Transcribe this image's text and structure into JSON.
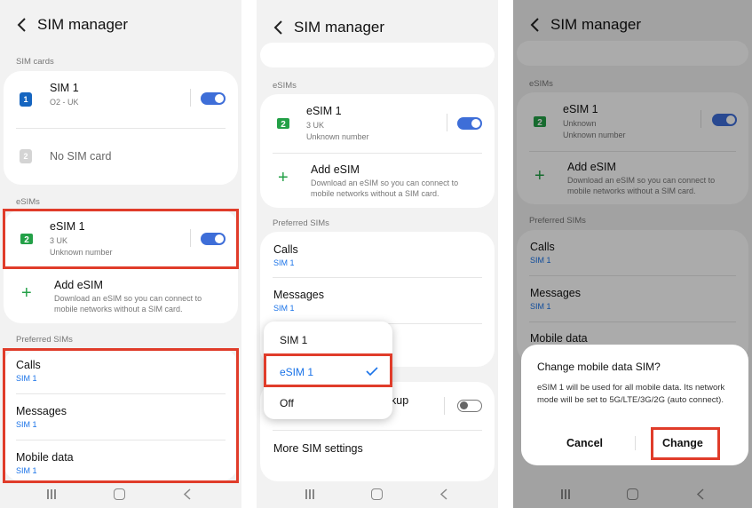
{
  "header": {
    "title": "SIM manager"
  },
  "sections": {
    "sim_cards": "SIM cards",
    "esims": "eSIMs",
    "preferred_sims": "Preferred SIMs"
  },
  "sim1": {
    "name": "SIM 1",
    "carrier": "O2 - UK",
    "slot_number": "1",
    "enabled": true
  },
  "sim2": {
    "name": "No SIM card",
    "slot_number": "2"
  },
  "esim1": {
    "name": "eSIM 1",
    "carrier": "3 UK",
    "number": "Unknown number",
    "slot_number": "2",
    "enabled": true
  },
  "esim1_dialog_screen": {
    "carrier": "Unknown",
    "number": "Unknown number"
  },
  "add_esim": {
    "title": "Add eSIM",
    "description": "Download an eSIM so you can connect to mobile networks without a SIM card."
  },
  "preferred": {
    "calls": {
      "label": "Calls",
      "value": "SIM 1"
    },
    "messages": {
      "label": "Messages",
      "value": "SIM 1"
    },
    "mobile_data": {
      "label": "Mobile data",
      "value": "SIM 1"
    }
  },
  "dropdown": {
    "options": [
      "SIM 1",
      "eSIM 1",
      "Off"
    ],
    "selected": "eSIM 1"
  },
  "data_switch_backup_partial": "kup",
  "more_sim_settings": "More SIM settings",
  "dialog": {
    "title": "Change mobile data SIM?",
    "body": "eSIM 1 will be used for all mobile data. Its network mode will be set to 5G/LTE/3G/2G (auto connect).",
    "cancel": "Cancel",
    "confirm": "Change"
  },
  "colors": {
    "accent": "#3e6ed8",
    "link": "#1a73e8",
    "highlight": "#e03c2a",
    "esim_green": "#23a047"
  }
}
